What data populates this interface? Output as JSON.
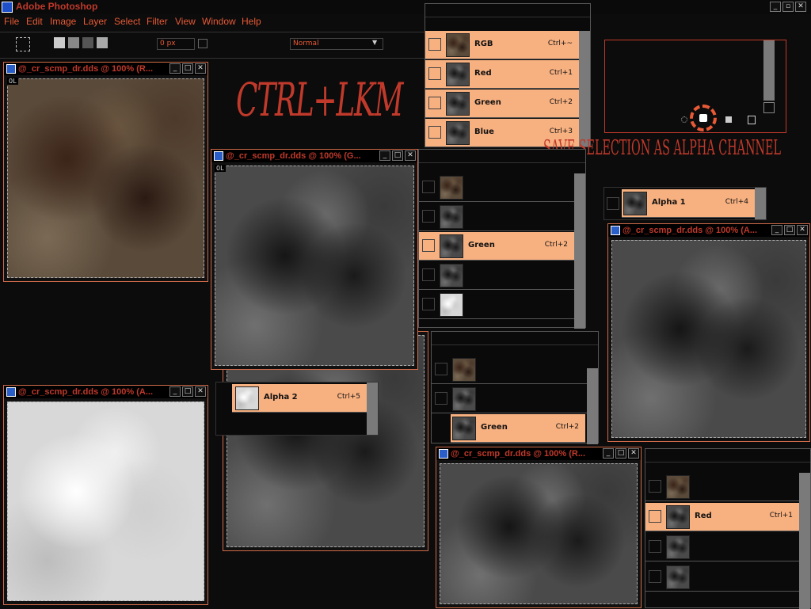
{
  "app": {
    "title": "Adobe Photoshop"
  },
  "menu": [
    "File",
    "Edit",
    "Image",
    "Layer",
    "Select",
    "Filter",
    "View",
    "Window",
    "Help"
  ],
  "options": {
    "feather_value": "0 px",
    "style_value": "Normal"
  },
  "overlay": {
    "ctrl_text": "CTRL+LKM",
    "save_text": "SAVE SELECTION AS ALPHA CHANNEL"
  },
  "docs": [
    {
      "title": "@_cr_scmp_dr.dds @ 100% (R..."
    },
    {
      "title": "@_cr_scmp_dr.dds @ 100% (G..."
    },
    {
      "title": "@_cr_scmp_dr.dds @ 100% (A..."
    },
    {
      "title": "@_cr_scmp_dr.dds @ 100% (A..."
    },
    {
      "title": "@_cr_scmp_dr.dds @ 100% (R..."
    }
  ],
  "ruler_tag": "0L",
  "panels": {
    "p1": [
      {
        "name": "RGB",
        "key": "Ctrl+~"
      },
      {
        "name": "Red",
        "key": "Ctrl+1"
      },
      {
        "name": "Green",
        "key": "Ctrl+2"
      },
      {
        "name": "Blue",
        "key": "Ctrl+3"
      }
    ],
    "p2_active": {
      "name": "Green",
      "key": "Ctrl+2"
    },
    "alpha1": {
      "name": "Alpha 1",
      "key": "Ctrl+4"
    },
    "alpha2": {
      "name": "Alpha 2",
      "key": "Ctrl+5"
    },
    "p3_active": {
      "name": "Green",
      "key": "Ctrl+2"
    },
    "p4_active": {
      "name": "Red",
      "key": "Ctrl+1"
    }
  },
  "colors": {
    "accent": "#c0392b",
    "highlight": "#f7b080"
  }
}
